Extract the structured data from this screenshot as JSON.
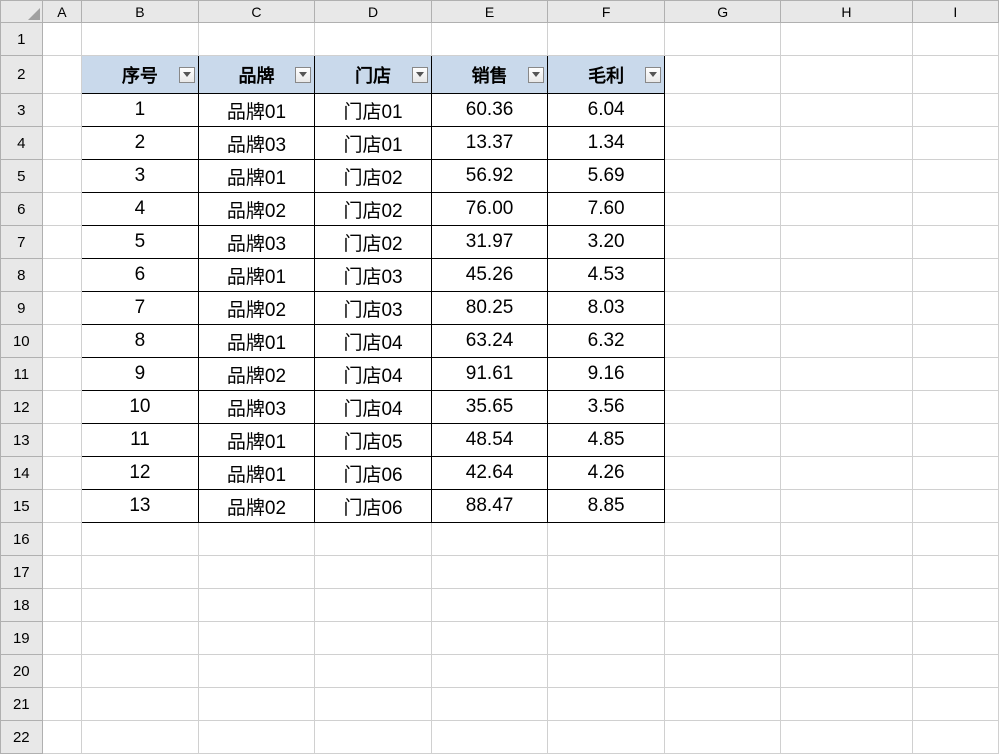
{
  "sheet": {
    "columns": [
      "A",
      "B",
      "C",
      "D",
      "E",
      "F",
      "G",
      "H",
      "I"
    ],
    "rows": [
      "1",
      "2",
      "3",
      "4",
      "5",
      "6",
      "7",
      "8",
      "9",
      "10",
      "11",
      "12",
      "13",
      "14",
      "15",
      "16",
      "17",
      "18",
      "19",
      "20",
      "21",
      "22"
    ]
  },
  "table": {
    "headers": {
      "seq": "序号",
      "brand": "品牌",
      "store": "门店",
      "sales": "销售",
      "profit": "毛利"
    },
    "rows": [
      {
        "seq": "1",
        "brand": "品牌01",
        "store": "门店01",
        "sales": "60.36",
        "profit": "6.04"
      },
      {
        "seq": "2",
        "brand": "品牌03",
        "store": "门店01",
        "sales": "13.37",
        "profit": "1.34"
      },
      {
        "seq": "3",
        "brand": "品牌01",
        "store": "门店02",
        "sales": "56.92",
        "profit": "5.69"
      },
      {
        "seq": "4",
        "brand": "品牌02",
        "store": "门店02",
        "sales": "76.00",
        "profit": "7.60"
      },
      {
        "seq": "5",
        "brand": "品牌03",
        "store": "门店02",
        "sales": "31.97",
        "profit": "3.20"
      },
      {
        "seq": "6",
        "brand": "品牌01",
        "store": "门店03",
        "sales": "45.26",
        "profit": "4.53"
      },
      {
        "seq": "7",
        "brand": "品牌02",
        "store": "门店03",
        "sales": "80.25",
        "profit": "8.03"
      },
      {
        "seq": "8",
        "brand": "品牌01",
        "store": "门店04",
        "sales": "63.24",
        "profit": "6.32"
      },
      {
        "seq": "9",
        "brand": "品牌02",
        "store": "门店04",
        "sales": "91.61",
        "profit": "9.16"
      },
      {
        "seq": "10",
        "brand": "品牌03",
        "store": "门店04",
        "sales": "35.65",
        "profit": "3.56"
      },
      {
        "seq": "11",
        "brand": "品牌01",
        "store": "门店05",
        "sales": "48.54",
        "profit": "4.85"
      },
      {
        "seq": "12",
        "brand": "品牌01",
        "store": "门店06",
        "sales": "42.64",
        "profit": "4.26"
      },
      {
        "seq": "13",
        "brand": "品牌02",
        "store": "门店06",
        "sales": "88.47",
        "profit": "8.85"
      }
    ]
  }
}
